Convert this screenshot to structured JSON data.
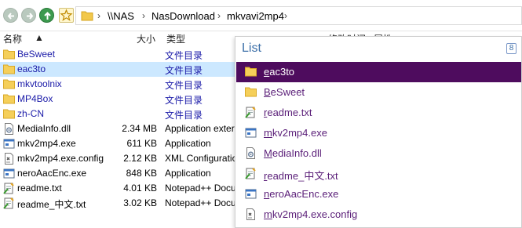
{
  "address": {
    "crumbs": [
      "\\\\NAS",
      "NasDownload",
      "mkvavi2mp4"
    ]
  },
  "columns": {
    "name": "名称",
    "size": "大小",
    "type": "类型",
    "modified": "修改时间",
    "attr": "属性"
  },
  "files": [
    {
      "name": "BeSweet",
      "size": "",
      "type": "文件目录",
      "kind": "folder"
    },
    {
      "name": "eac3to",
      "size": "",
      "type": "文件目录",
      "kind": "folder",
      "selected": true
    },
    {
      "name": "mkvtoolnix",
      "size": "",
      "type": "文件目录",
      "kind": "folder"
    },
    {
      "name": "MP4Box",
      "size": "",
      "type": "文件目录",
      "kind": "folder"
    },
    {
      "name": "zh-CN",
      "size": "",
      "type": "文件目录",
      "kind": "folder"
    },
    {
      "name": "MediaInfo.dll",
      "size": "2.34 MB",
      "type": "Application exter",
      "kind": "dll"
    },
    {
      "name": "mkv2mp4.exe",
      "size": "611 KB",
      "type": "Application",
      "kind": "exe"
    },
    {
      "name": "mkv2mp4.exe.config",
      "size": "2.12 KB",
      "type": "XML Configuratio",
      "kind": "config"
    },
    {
      "name": "neroAacEnc.exe",
      "size": "848 KB",
      "type": "Application",
      "kind": "exe"
    },
    {
      "name": "readme.txt",
      "size": "4.01 KB",
      "type": "Notepad++ Docu",
      "kind": "txt"
    },
    {
      "name": "readme_中文.txt",
      "size": "3.02 KB",
      "type": "Notepad++ Docu",
      "kind": "txt"
    }
  ],
  "popup": {
    "title": "List",
    "count": "8",
    "items": [
      {
        "first": "e",
        "rest": "ac3to",
        "kind": "folder",
        "active": true
      },
      {
        "first": "B",
        "rest": "eSweet",
        "kind": "folder"
      },
      {
        "first": "r",
        "rest": "eadme.txt",
        "kind": "txt"
      },
      {
        "first": "m",
        "rest": "kv2mp4.exe",
        "kind": "exe"
      },
      {
        "first": "M",
        "rest": "ediaInfo.dll",
        "kind": "dll"
      },
      {
        "first": "r",
        "rest": "eadme_中文.txt",
        "kind": "txt"
      },
      {
        "first": "n",
        "rest": "eroAacEnc.exe",
        "kind": "exe"
      },
      {
        "first": "m",
        "rest": "kv2mp4.exe.config",
        "kind": "config"
      }
    ]
  },
  "colors": {
    "folder_text": "#1a1aa8",
    "selection": "#cce8ff",
    "popup_active": "#4e0c5e",
    "popup_text": "#5a1e78",
    "nav_green": "#3c9a4e"
  }
}
